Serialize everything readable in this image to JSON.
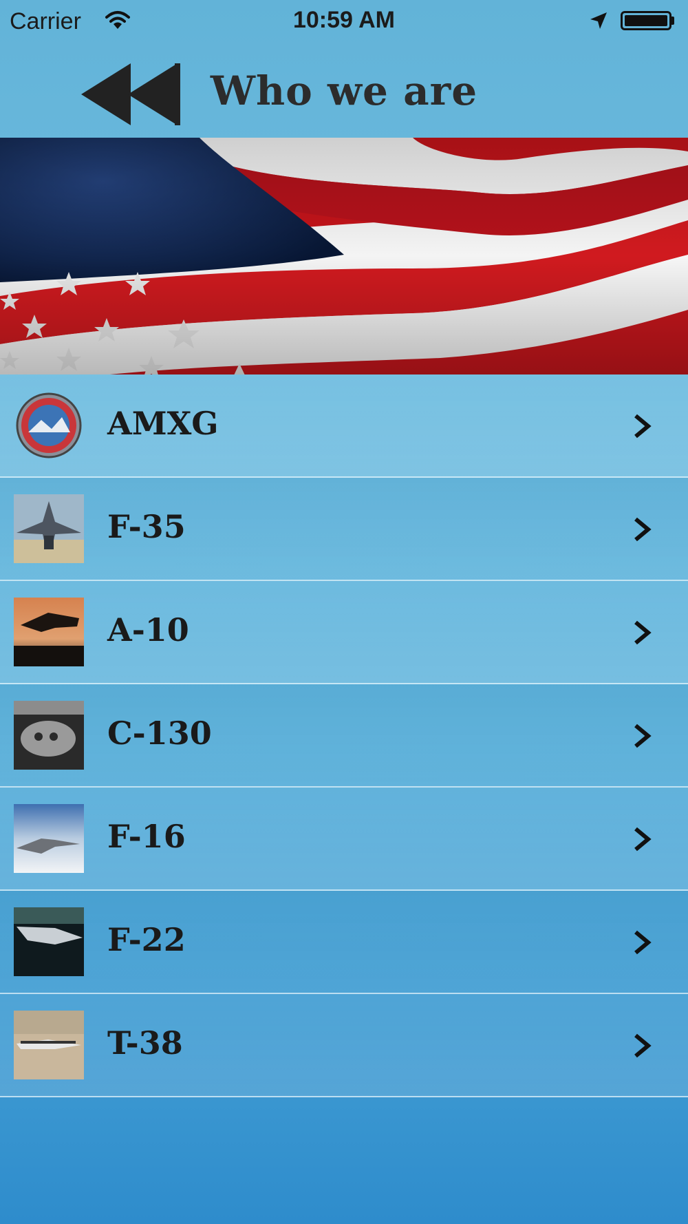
{
  "status_bar": {
    "carrier": "Carrier",
    "time": "10:59 AM",
    "icons": [
      "wifi-icon",
      "location-arrow-icon",
      "battery-icon"
    ]
  },
  "nav": {
    "title": "Who we are",
    "back_icon": "rewind-icon"
  },
  "banner": {
    "image": "american-flag"
  },
  "list": {
    "items": [
      {
        "label": "AMXG",
        "thumb": "amxg-emblem"
      },
      {
        "label": "F-35",
        "thumb": "f35-photo"
      },
      {
        "label": "A-10",
        "thumb": "a10-sunset-photo"
      },
      {
        "label": "C-130",
        "thumb": "c130-photo"
      },
      {
        "label": "F-16",
        "thumb": "f16-photo"
      },
      {
        "label": "F-22",
        "thumb": "f22-photo"
      },
      {
        "label": "T-38",
        "thumb": "t38-photo"
      }
    ],
    "chevron_icon": "chevron-right-icon"
  },
  "colors": {
    "background_top": "#62b3d8",
    "background_bottom": "#2e8ccc",
    "title_text": "#2c2c2c",
    "label_text": "#1a1a1a"
  }
}
